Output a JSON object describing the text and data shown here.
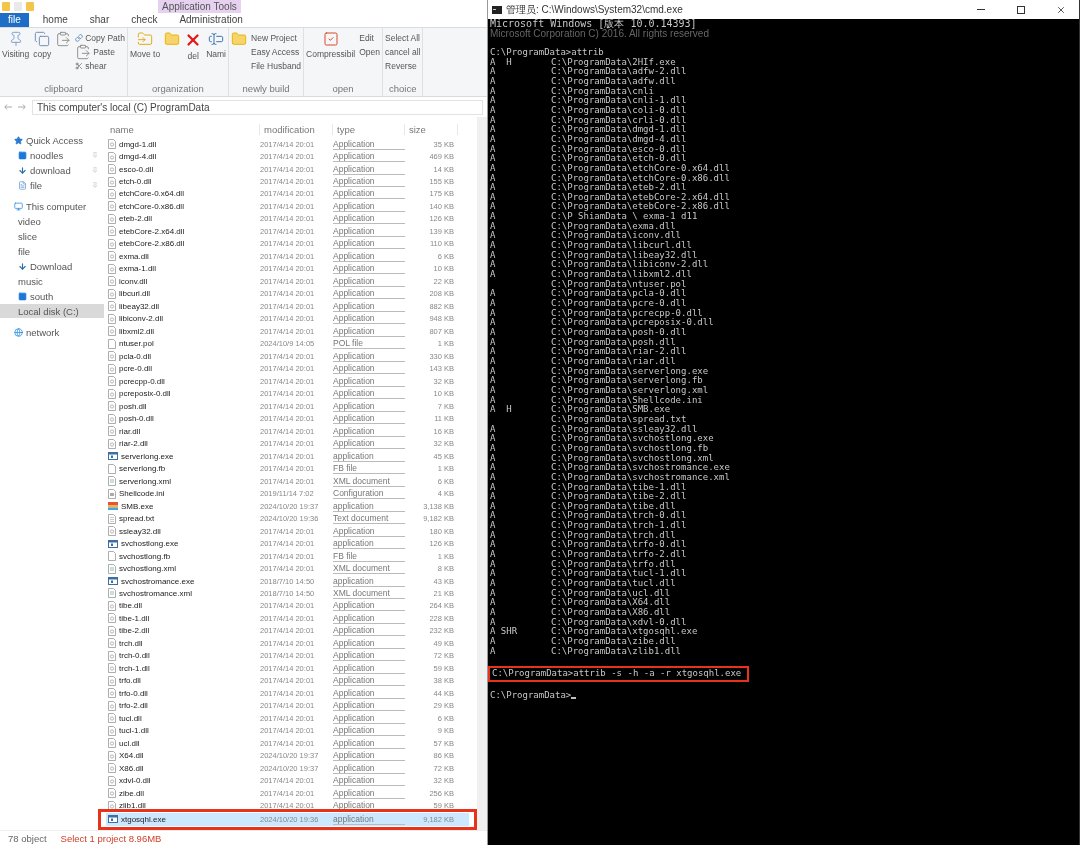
{
  "explorer": {
    "context_tab": "Application Tools",
    "tabs": [
      {
        "label": "file",
        "kind": "file"
      },
      {
        "label": "home",
        "kind": "tab"
      },
      {
        "label": "shar",
        "kind": "tab"
      },
      {
        "label": "check",
        "kind": "tab"
      },
      {
        "label": "Administration",
        "kind": "tab"
      }
    ],
    "ribbon_groups": [
      {
        "label": "clipboard",
        "buttons": [
          {
            "kind": "large",
            "label": "Visiting"
          },
          {
            "kind": "large",
            "label": "copy"
          },
          {
            "kind": "large"
          },
          {
            "kind": "small",
            "label": "Copy Path"
          },
          {
            "kind": "small",
            "label": "Paste"
          },
          {
            "kind": "small",
            "label": "shear"
          }
        ]
      },
      {
        "label": "organization",
        "buttons": [
          {
            "kind": "large",
            "label": "Move to"
          },
          {
            "kind": "large"
          },
          {
            "kind": "large",
            "label": "del"
          },
          {
            "kind": "large",
            "label": "Nami"
          }
        ]
      },
      {
        "label": "newly build",
        "buttons": [
          {
            "kind": "large"
          },
          {
            "kind": "small",
            "label": "New Project"
          },
          {
            "kind": "small",
            "label": "Easy Access"
          },
          {
            "kind": "small",
            "label": "File Husband"
          }
        ]
      },
      {
        "label": "open",
        "buttons": [
          {
            "kind": "large",
            "label": "Compressibil"
          },
          {
            "kind": "small",
            "label": "Edit"
          },
          {
            "kind": "small",
            "label": "Open"
          }
        ]
      },
      {
        "label": "choice",
        "buttons": [
          {
            "kind": "small",
            "label": "Select All"
          },
          {
            "kind": "small",
            "label": "cancel all"
          },
          {
            "kind": "small",
            "label": "Reverse"
          }
        ]
      }
    ],
    "address": "This computer's local (C) ProgramData",
    "nav": [
      {
        "label": "Quick Access",
        "kind": "quick",
        "pinned": false,
        "selected": false
      },
      {
        "label": "noodles",
        "kind": "desktop",
        "pinned": true,
        "selected": false
      },
      {
        "label": "download",
        "kind": "download",
        "pinned": true,
        "selected": false
      },
      {
        "label": "file",
        "kind": "document",
        "pinned": true,
        "selected": false
      },
      {
        "label": "This computer",
        "kind": "computer",
        "pinned": false,
        "selected": false
      },
      {
        "label": "video",
        "kind": "plain",
        "pinned": false,
        "selected": false
      },
      {
        "label": "slice",
        "kind": "plain",
        "pinned": false,
        "selected": false
      },
      {
        "label": "file",
        "kind": "plain",
        "pinned": false,
        "selected": false
      },
      {
        "label": "Download",
        "kind": "download",
        "pinned": false,
        "selected": false
      },
      {
        "label": "music",
        "kind": "plain",
        "pinned": false,
        "selected": false
      },
      {
        "label": "south",
        "kind": "desktop",
        "pinned": false,
        "selected": false
      },
      {
        "label": "Local disk (C:)",
        "kind": "plain",
        "pinned": false,
        "selected": true
      },
      {
        "label": "network",
        "kind": "network",
        "pinned": false,
        "selected": false
      }
    ],
    "columns": [
      "name",
      "modification",
      "type",
      "size"
    ],
    "files": [
      {
        "name": "dmgd-1.dll",
        "date": "2017/4/14 20:01",
        "type": "Application",
        "size": "35 KB",
        "kind": "dll",
        "selected": false
      },
      {
        "name": "dmgd-4.dll",
        "date": "2017/4/14 20:01",
        "type": "Application",
        "size": "469 KB",
        "kind": "dll",
        "selected": false
      },
      {
        "name": "esco-0.dll",
        "date": "2017/4/14 20:01",
        "type": "Application",
        "size": "14 KB",
        "kind": "dll",
        "selected": false
      },
      {
        "name": "etch-0.dll",
        "date": "2017/4/14 20:01",
        "type": "Application",
        "size": "155 KB",
        "kind": "dll",
        "selected": false
      },
      {
        "name": "etchCore-0.x64.dll",
        "date": "2017/4/14 20:01",
        "type": "Application",
        "size": "175 KB",
        "kind": "dll",
        "selected": false
      },
      {
        "name": "etchCore-0.x86.dll",
        "date": "2017/4/14 20:01",
        "type": "Application",
        "size": "140 KB",
        "kind": "dll",
        "selected": false
      },
      {
        "name": "eteb-2.dll",
        "date": "2017/4/14 20:01",
        "type": "Application",
        "size": "126 KB",
        "kind": "dll",
        "selected": false
      },
      {
        "name": "etebCore-2.x64.dll",
        "date": "2017/4/14 20:01",
        "type": "Application",
        "size": "139 KB",
        "kind": "dll",
        "selected": false
      },
      {
        "name": "etebCore-2.x86.dll",
        "date": "2017/4/14 20:01",
        "type": "Application",
        "size": "110 KB",
        "kind": "dll",
        "selected": false
      },
      {
        "name": "exma.dll",
        "date": "2017/4/14 20:01",
        "type": "Application",
        "size": "6 KB",
        "kind": "dll",
        "selected": false
      },
      {
        "name": "exma-1.dll",
        "date": "2017/4/14 20:01",
        "type": "Application",
        "size": "10 KB",
        "kind": "dll",
        "selected": false
      },
      {
        "name": "iconv.dll",
        "date": "2017/4/14 20:01",
        "type": "Application",
        "size": "22 KB",
        "kind": "dll",
        "selected": false
      },
      {
        "name": "libcurl.dll",
        "date": "2017/4/14 20:01",
        "type": "Application",
        "size": "208 KB",
        "kind": "dll",
        "selected": false
      },
      {
        "name": "libeay32.dll",
        "date": "2017/4/14 20:01",
        "type": "Application",
        "size": "882 KB",
        "kind": "dll",
        "selected": false
      },
      {
        "name": "libiconv-2.dll",
        "date": "2017/4/14 20:01",
        "type": "Application",
        "size": "948 KB",
        "kind": "dll",
        "selected": false
      },
      {
        "name": "libxml2.dll",
        "date": "2017/4/14 20:01",
        "type": "Application",
        "size": "807 KB",
        "kind": "dll",
        "selected": false
      },
      {
        "name": "ntuser.pol",
        "date": "2024/10/9 14:05",
        "type": "POL file",
        "size": "1 KB",
        "kind": "blank",
        "selected": false
      },
      {
        "name": "pcla-0.dll",
        "date": "2017/4/14 20:01",
        "type": "Application",
        "size": "330 KB",
        "kind": "dll",
        "selected": false
      },
      {
        "name": "pcre-0.dll",
        "date": "2017/4/14 20:01",
        "type": "Application",
        "size": "143 KB",
        "kind": "dll",
        "selected": false
      },
      {
        "name": "pcrecpp-0.dll",
        "date": "2017/4/14 20:01",
        "type": "Application",
        "size": "32 KB",
        "kind": "dll",
        "selected": false
      },
      {
        "name": "pcreposix-0.dll",
        "date": "2017/4/14 20:01",
        "type": "Application",
        "size": "10 KB",
        "kind": "dll",
        "selected": false
      },
      {
        "name": "posh.dll",
        "date": "2017/4/14 20:01",
        "type": "Application",
        "size": "7 KB",
        "kind": "dll",
        "selected": false
      },
      {
        "name": "posh-0.dll",
        "date": "2017/4/14 20:01",
        "type": "Application",
        "size": "11 KB",
        "kind": "dll",
        "selected": false
      },
      {
        "name": "riar.dll",
        "date": "2017/4/14 20:01",
        "type": "Application",
        "size": "16 KB",
        "kind": "dll",
        "selected": false
      },
      {
        "name": "riar-2.dll",
        "date": "2017/4/14 20:01",
        "type": "Application",
        "size": "32 KB",
        "kind": "dll",
        "selected": false
      },
      {
        "name": "serverlong.exe",
        "date": "2017/4/14 20:01",
        "type": "application",
        "size": "45 KB",
        "kind": "exe",
        "selected": false
      },
      {
        "name": "serverlong.fb",
        "date": "2017/4/14 20:01",
        "type": "FB file",
        "size": "1 KB",
        "kind": "blank",
        "selected": false
      },
      {
        "name": "serverlong.xml",
        "date": "2017/4/14 20:01",
        "type": "XML document",
        "size": "6 KB",
        "kind": "xml",
        "selected": false
      },
      {
        "name": "Shellcode.ini",
        "date": "2019/11/14 7:02",
        "type": "Configuration",
        "size": "4 KB",
        "kind": "ini",
        "selected": false
      },
      {
        "name": "SMB.exe",
        "date": "2024/10/20 19:37",
        "type": "application",
        "size": "3,138 KB",
        "kind": "app",
        "selected": false
      },
      {
        "name": "spread.txt",
        "date": "2024/10/20 19:36",
        "type": "Text document",
        "size": "9,182 KB",
        "kind": "txt",
        "selected": false
      },
      {
        "name": "ssleay32.dll",
        "date": "2017/4/14 20:01",
        "type": "Application",
        "size": "180 KB",
        "kind": "dll",
        "selected": false
      },
      {
        "name": "svchostlong.exe",
        "date": "2017/4/14 20:01",
        "type": "application",
        "size": "126 KB",
        "kind": "exe",
        "selected": false
      },
      {
        "name": "svchostlong.fb",
        "date": "2017/4/14 20:01",
        "type": "FB file",
        "size": "1 KB",
        "kind": "blank",
        "selected": false
      },
      {
        "name": "svchostlong.xml",
        "date": "2017/4/14 20:01",
        "type": "XML document",
        "size": "8 KB",
        "kind": "xml",
        "selected": false
      },
      {
        "name": "svchostromance.exe",
        "date": "2018/7/10 14:50",
        "type": "application",
        "size": "43 KB",
        "kind": "exe",
        "selected": false
      },
      {
        "name": "svchostromance.xml",
        "date": "2018/7/10 14:50",
        "type": "XML document",
        "size": "21 KB",
        "kind": "xml",
        "selected": false
      },
      {
        "name": "tibe.dll",
        "date": "2017/4/14 20:01",
        "type": "Application",
        "size": "264 KB",
        "kind": "dll",
        "selected": false
      },
      {
        "name": "tibe-1.dll",
        "date": "2017/4/14 20:01",
        "type": "Application",
        "size": "228 KB",
        "kind": "dll",
        "selected": false
      },
      {
        "name": "tibe-2.dll",
        "date": "2017/4/14 20:01",
        "type": "Application",
        "size": "232 KB",
        "kind": "dll",
        "selected": false
      },
      {
        "name": "trch.dll",
        "date": "2017/4/14 20:01",
        "type": "Application",
        "size": "49 KB",
        "kind": "dll",
        "selected": false
      },
      {
        "name": "trch-0.dll",
        "date": "2017/4/14 20:01",
        "type": "Application",
        "size": "72 KB",
        "kind": "dll",
        "selected": false
      },
      {
        "name": "trch-1.dll",
        "date": "2017/4/14 20:01",
        "type": "Application",
        "size": "59 KB",
        "kind": "dll",
        "selected": false
      },
      {
        "name": "trfo.dll",
        "date": "2017/4/14 20:01",
        "type": "Application",
        "size": "38 KB",
        "kind": "dll",
        "selected": false
      },
      {
        "name": "trfo-0.dll",
        "date": "2017/4/14 20:01",
        "type": "Application",
        "size": "44 KB",
        "kind": "dll",
        "selected": false
      },
      {
        "name": "trfo-2.dll",
        "date": "2017/4/14 20:01",
        "type": "Application",
        "size": "29 KB",
        "kind": "dll",
        "selected": false
      },
      {
        "name": "tucl.dll",
        "date": "2017/4/14 20:01",
        "type": "Application",
        "size": "6 KB",
        "kind": "dll",
        "selected": false
      },
      {
        "name": "tucl-1.dll",
        "date": "2017/4/14 20:01",
        "type": "Application",
        "size": "9 KB",
        "kind": "dll",
        "selected": false
      },
      {
        "name": "ucl.dll",
        "date": "2017/4/14 20:01",
        "type": "Application",
        "size": "57 KB",
        "kind": "dll",
        "selected": false
      },
      {
        "name": "X64.dll",
        "date": "2024/10/20 19:37",
        "type": "Application",
        "size": "86 KB",
        "kind": "dll",
        "selected": false
      },
      {
        "name": "X86.dll",
        "date": "2024/10/20 19:37",
        "type": "Application",
        "size": "72 KB",
        "kind": "dll",
        "selected": false
      },
      {
        "name": "xdvl-0.dll",
        "date": "2017/4/14 20:01",
        "type": "Application",
        "size": "32 KB",
        "kind": "dll",
        "selected": false
      },
      {
        "name": "zibe.dll",
        "date": "2017/4/14 20:01",
        "type": "Application",
        "size": "256 KB",
        "kind": "dll",
        "selected": false
      },
      {
        "name": "zlib1.dll",
        "date": "2017/4/14 20:01",
        "type": "Application",
        "size": "59 KB",
        "kind": "dll",
        "selected": false
      },
      {
        "name": "xtgosqhl.exe",
        "date": "2024/10/20 19:36",
        "type": "application",
        "size": "9,182 KB",
        "kind": "exe",
        "selected": true
      }
    ],
    "status": {
      "count": "78 object",
      "selection": "Select 1 project 8.96MB"
    }
  },
  "console": {
    "title": "管理员: C:\\Windows\\System32\\cmd.exe",
    "header": [
      {
        "text": "Microsoft Windows [版本 10.0.14393]",
        "kind": "mono"
      },
      {
        "text": "Microsoft Corporation C) 2016. All rights reserved",
        "kind": "overlay"
      }
    ],
    "first_command": "C:\\ProgramData>attrib",
    "lines": [
      {
        "attr": "A  H",
        "path": "C:\\ProgramData\\2HIf.exe"
      },
      {
        "attr": "A",
        "path": "C:\\ProgramData\\adfw-2.dll"
      },
      {
        "attr": "A",
        "path": "C:\\ProgramData\\adfw.dll"
      },
      {
        "attr": "A",
        "path": "C:\\ProgramData\\cnli"
      },
      {
        "attr": "A",
        "path": "C:\\ProgramData\\cnli-1.dll"
      },
      {
        "attr": "A",
        "path": "C:\\ProgramData\\coli-0.dll"
      },
      {
        "attr": "A",
        "path": "C:\\ProgramData\\crli-0.dll"
      },
      {
        "attr": "A",
        "path": "C:\\ProgramData\\dmgd-1.dll"
      },
      {
        "attr": "A",
        "path": "C:\\ProgramData\\dmgd-4.dll"
      },
      {
        "attr": "A",
        "path": "C:\\ProgramData\\esco-0.dll"
      },
      {
        "attr": "A",
        "path": "C:\\ProgramData\\etch-0.dll"
      },
      {
        "attr": "A",
        "path": "C:\\ProgramData\\etchCore-0.x64.dll"
      },
      {
        "attr": "A",
        "path": "C:\\ProgramData\\etchCore-0.x86.dll"
      },
      {
        "attr": "A",
        "path": "C:\\ProgramData\\eteb-2.dll"
      },
      {
        "attr": "A",
        "path": "C:\\ProgramData\\etebCore-2.x64.dll"
      },
      {
        "attr": "A",
        "path": "C:\\ProgramData\\etebCore-2.x86.dll"
      },
      {
        "attr": "A",
        "path": "C:\\P ShiamData \\ exma-1 d11"
      },
      {
        "attr": "A",
        "path": "C:\\ProgramData\\exma.dll"
      },
      {
        "attr": "A",
        "path": "C:\\ProgramData\\iconv.dll"
      },
      {
        "attr": "A",
        "path": "C:\\ProgramData\\libcurl.dll"
      },
      {
        "attr": "A",
        "path": "C:\\ProgramData\\libeay32.dll"
      },
      {
        "attr": "A",
        "path": "C:\\ProgramData\\libiconv-2.dll"
      },
      {
        "attr": "A",
        "path": "C:\\ProgramData\\libxml2.dll"
      },
      {
        "path": "C:\\ProgramData\\ntuser.pol"
      },
      {
        "attr": "A",
        "path": "C:\\ProgramData\\pcla-0.dll"
      },
      {
        "attr": "A",
        "path": "C:\\ProgramData\\pcre-0.dll"
      },
      {
        "attr": "A",
        "path": "C:\\ProgramData\\pcrecpp-0.dll"
      },
      {
        "attr": "A",
        "path": "C:\\ProgramData\\pcreposix-0.dll"
      },
      {
        "attr": "A",
        "path": "C:\\ProgramData\\posh-0.dll"
      },
      {
        "attr": "A",
        "path": "C:\\ProgramData\\posh.dll"
      },
      {
        "attr": "A",
        "path": "C:\\ProgramData\\riar-2.dll"
      },
      {
        "attr": "A",
        "path": "C:\\ProgramData\\riar.dll"
      },
      {
        "attr": "A",
        "path": "C:\\ProgramData\\serverlong.exe"
      },
      {
        "attr": "A",
        "path": "C:\\ProgramData\\serverlong.fb"
      },
      {
        "attr": "A",
        "path": "C:\\ProgramData\\serverlong.xml"
      },
      {
        "attr": "A",
        "path": "C:\\ProgramData\\Shellcode.ini"
      },
      {
        "attr": "A  H",
        "path": "C:\\ProgramData\\SMB.exe"
      },
      {
        "path": "C:\\ProgramData\\spread.txt"
      },
      {
        "attr": "A",
        "path": "C:\\ProgramData\\ssleay32.dll"
      },
      {
        "attr": "A",
        "path": "C:\\ProgramData\\svchostlong.exe"
      },
      {
        "attr": "A",
        "path": "C:\\ProgramData\\svchostlong.fb"
      },
      {
        "attr": "A",
        "path": "C:\\ProgramData\\svchostlong.xml"
      },
      {
        "attr": "A",
        "path": "C:\\ProgramData\\svchostromance.exe"
      },
      {
        "attr": "A",
        "path": "C:\\ProgramData\\svchostromance.xml"
      },
      {
        "attr": "A",
        "path": "C:\\ProgramData\\tibe-1.dll"
      },
      {
        "attr": "A",
        "path": "C:\\ProgramData\\tibe-2.dll"
      },
      {
        "attr": "A",
        "path": "C:\\ProgramData\\tibe.dll"
      },
      {
        "attr": "A",
        "path": "C:\\ProgramData\\trch-0.dll"
      },
      {
        "attr": "A",
        "path": "C:\\ProgramData\\trch-1.dll"
      },
      {
        "attr": "A",
        "path": "C:\\ProgramData\\trch.dll"
      },
      {
        "attr": "A",
        "path": "C:\\ProgramData\\trfo-0.dll"
      },
      {
        "attr": "A",
        "path": "C:\\ProgramData\\trfo-2.dll"
      },
      {
        "attr": "A",
        "path": "C:\\ProgramData\\trfo.dll"
      },
      {
        "attr": "A",
        "path": "C:\\ProgramData\\tucl-1.dll"
      },
      {
        "attr": "A",
        "path": "C:\\ProgramData\\tucl.dll"
      },
      {
        "attr": "A",
        "path": "C:\\ProgramData\\ucl.dll"
      },
      {
        "attr": "A",
        "path": "C:\\ProgramData\\X64.dll"
      },
      {
        "attr": "A",
        "path": "C:\\ProgramData\\X86.dll"
      },
      {
        "attr": "A",
        "path": "C:\\ProgramData\\xdvl-0.dll"
      },
      {
        "attr": "A SHR",
        "path": "C:\\ProgramData\\xtgosqhl.exe"
      },
      {
        "attr": "A",
        "path": "C:\\ProgramData\\zibe.dll"
      },
      {
        "attr": "A",
        "path": "C:\\ProgramData\\zlib1.dll"
      }
    ],
    "command": "C:\\ProgramData>attrib -s -h -a -r xtgosqhl.exe",
    "prompt": "C:\\ProgramData>"
  }
}
